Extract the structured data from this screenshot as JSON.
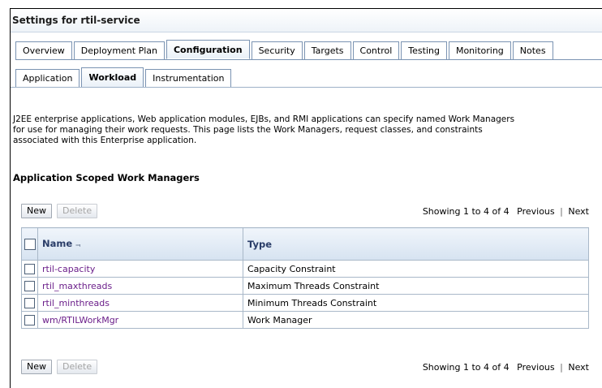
{
  "page": {
    "title": "Settings for rtil-service"
  },
  "tabs": [
    {
      "label": "Overview",
      "active": false
    },
    {
      "label": "Deployment Plan",
      "active": false
    },
    {
      "label": "Configuration",
      "active": true
    },
    {
      "label": "Security",
      "active": false
    },
    {
      "label": "Targets",
      "active": false
    },
    {
      "label": "Control",
      "active": false
    },
    {
      "label": "Testing",
      "active": false
    },
    {
      "label": "Monitoring",
      "active": false
    },
    {
      "label": "Notes",
      "active": false
    }
  ],
  "subtabs": [
    {
      "label": "Application",
      "active": false
    },
    {
      "label": "Workload",
      "active": true
    },
    {
      "label": "Instrumentation",
      "active": false
    }
  ],
  "description": {
    "line1": "J2EE enterprise applications, Web application modules, EJBs, and RMI applications can specify named Work Managers",
    "line2": "for use for managing their work requests. This page lists the Work Managers, request classes, and constraints",
    "line3": "associated with this Enterprise application."
  },
  "section": {
    "title": "Application Scoped Work Managers"
  },
  "toolbar": {
    "new_label": "New",
    "delete_label": "Delete",
    "paging_text": "Showing 1 to 4 of 4",
    "previous_label": "Previous",
    "separator": "|",
    "next_label": "Next"
  },
  "table": {
    "columns": {
      "name": "Name",
      "type": "Type"
    },
    "sort_icon": "sort-ascending-icon",
    "rows": [
      {
        "name": "rtil-capacity",
        "type": "Capacity Constraint"
      },
      {
        "name": "rtil_maxthreads",
        "type": "Maximum Threads Constraint"
      },
      {
        "name": "rtil_minthreads",
        "type": "Minimum Threads Constraint"
      },
      {
        "name": "wm/RTILWorkMgr",
        "type": "Work Manager"
      }
    ]
  },
  "colors": {
    "link": "#6b1f8a",
    "header_text": "#2a3d68",
    "tab_border": "#7a93b2"
  }
}
